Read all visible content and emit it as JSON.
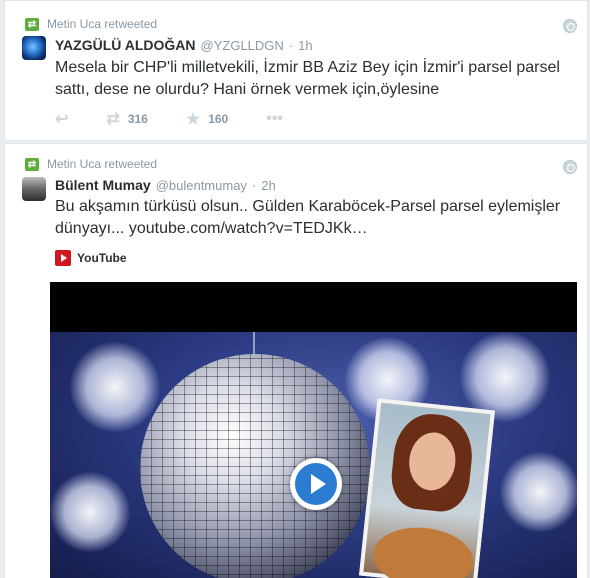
{
  "tweets": [
    {
      "retweeted_by": "Metin Uca retweeted",
      "name": "YAZGÜLÜ ALDOĞAN",
      "handle": "@YZGLLDGN",
      "separator": "·",
      "time": "1h",
      "text": "Mesela bir CHP'li milletvekili, İzmir BB Aziz Bey için İzmir'i parsel parsel sattı, dese ne olurdu? Hani örnek vermek için,öylesine",
      "actions": {
        "retweet_count": "316",
        "like_count": "160",
        "more": "•••"
      }
    },
    {
      "retweeted_by": "Metin Uca retweeted",
      "name": "Bülent Mumay",
      "handle": "@bulentmumay",
      "separator": "·",
      "time": "2h",
      "text": "Bu akşamın türküsü olsun.. Gülden Karaböcek-Parsel parsel eylemişler dünyayı...",
      "link": "youtube.com/watch?v=TEDJKk…",
      "card_source": "YouTube"
    }
  ],
  "icons": {
    "retweet": "retweet-icon",
    "reply": "reply-icon",
    "star": "star-icon",
    "globe": "globe-icon",
    "play": "play-icon"
  },
  "colors": {
    "retweet_green": "#5cad3c",
    "muted": "#8899a6",
    "text": "#292f33",
    "youtube_red": "#cc181e",
    "play_blue": "#2b7bd0"
  }
}
